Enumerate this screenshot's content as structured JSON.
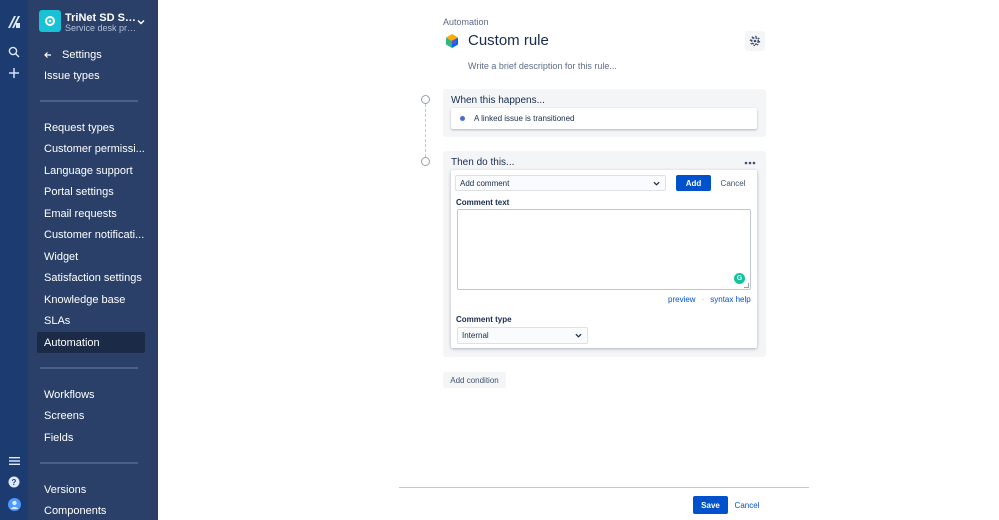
{
  "project": {
    "name": "TriNet SD Supp...",
    "subtitle": "Service desk proje..."
  },
  "sidebar": {
    "back_label": "Settings",
    "items": [
      {
        "label": "Issue types"
      },
      {
        "label": "Request types"
      },
      {
        "label": "Customer permissi..."
      },
      {
        "label": "Language support"
      },
      {
        "label": "Portal settings"
      },
      {
        "label": "Email requests"
      },
      {
        "label": "Customer notificati..."
      },
      {
        "label": "Widget"
      },
      {
        "label": "Satisfaction settings"
      },
      {
        "label": "Knowledge base"
      },
      {
        "label": "SLAs"
      },
      {
        "label": "Automation",
        "active": true
      },
      {
        "label": "Workflows"
      },
      {
        "label": "Screens"
      },
      {
        "label": "Fields"
      },
      {
        "label": "Versions"
      },
      {
        "label": "Components"
      }
    ]
  },
  "main": {
    "breadcrumb": "Automation",
    "title": "Custom rule",
    "description_placeholder": "Write a brief description for this rule...",
    "when": {
      "heading": "When this happens...",
      "trigger": "A linked issue is transitioned"
    },
    "then": {
      "heading": "Then do this...",
      "action_select": "Add comment",
      "add_label": "Add",
      "cancel_label": "Cancel",
      "comment_text_label": "Comment text",
      "comment_text_value": "",
      "preview_label": "preview",
      "link_separator": "·",
      "syntax_help_label": "syntax help",
      "comment_type_label": "Comment type",
      "comment_type_value": "Internal"
    },
    "add_condition_label": "Add condition",
    "footer": {
      "save_label": "Save",
      "cancel_label": "Cancel"
    }
  },
  "icons": {
    "app_logo": "jira-logo-icon",
    "search": "search-icon",
    "create": "plus-icon",
    "menu": "hamburger-icon",
    "help": "help-icon",
    "profile": "avatar-icon",
    "settings": "gear-icon",
    "back": "arrow-left-icon",
    "more": "more-icon",
    "grammarly": "grammarly-icon"
  },
  "colors": {
    "rail": "#1c3b70",
    "sidebar": "#2a4068",
    "active_item": "#1b2a46",
    "primary": "#0052cc",
    "panel": "#f4f5f7"
  }
}
